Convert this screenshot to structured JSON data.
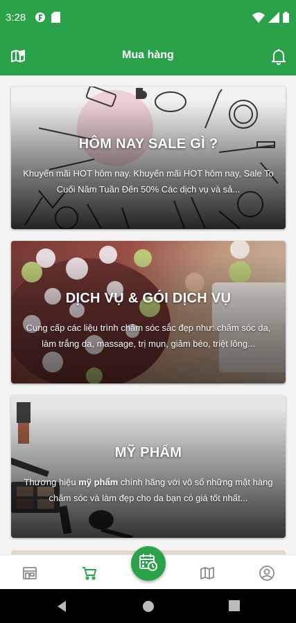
{
  "status_bar": {
    "time": "3:28"
  },
  "app_bar": {
    "title": "Mua hàng"
  },
  "cards": [
    {
      "title": "HÔM NAY SALE GÌ ?",
      "description": "Khuyến mãi HOT hôm nay. Khuyến mãi HOT hôm nay, Sale To Cuối Năm Tuần Đến 50% Các dịch vụ và sả..."
    },
    {
      "title": "DỊCH VỤ & GÓI DỊCH VỤ",
      "description": "Cung cấp các liệu trình chăm sóc sắc đẹp như: chăm sóc da, làm trắng da, massage, trị mụn, giảm béo, triệt lông..."
    },
    {
      "title": "MỸ PHẨM",
      "description_prefix": "Thương hiệu ",
      "description_bold": "mỹ phẩm",
      "description_suffix": " chính hãng với vô số những mặt hàng chăm sóc và làm đẹp cho da bạn có giá tốt nhất..."
    }
  ],
  "bottom_nav": {
    "items": [
      "store-icon",
      "cart-icon",
      "calendar-clock-icon",
      "map-icon",
      "account-icon"
    ],
    "active": "cart-icon"
  },
  "colors": {
    "primary": "#2aa24a",
    "background": "#f4f4f4",
    "inactive_icon": "#8a8a8a"
  }
}
